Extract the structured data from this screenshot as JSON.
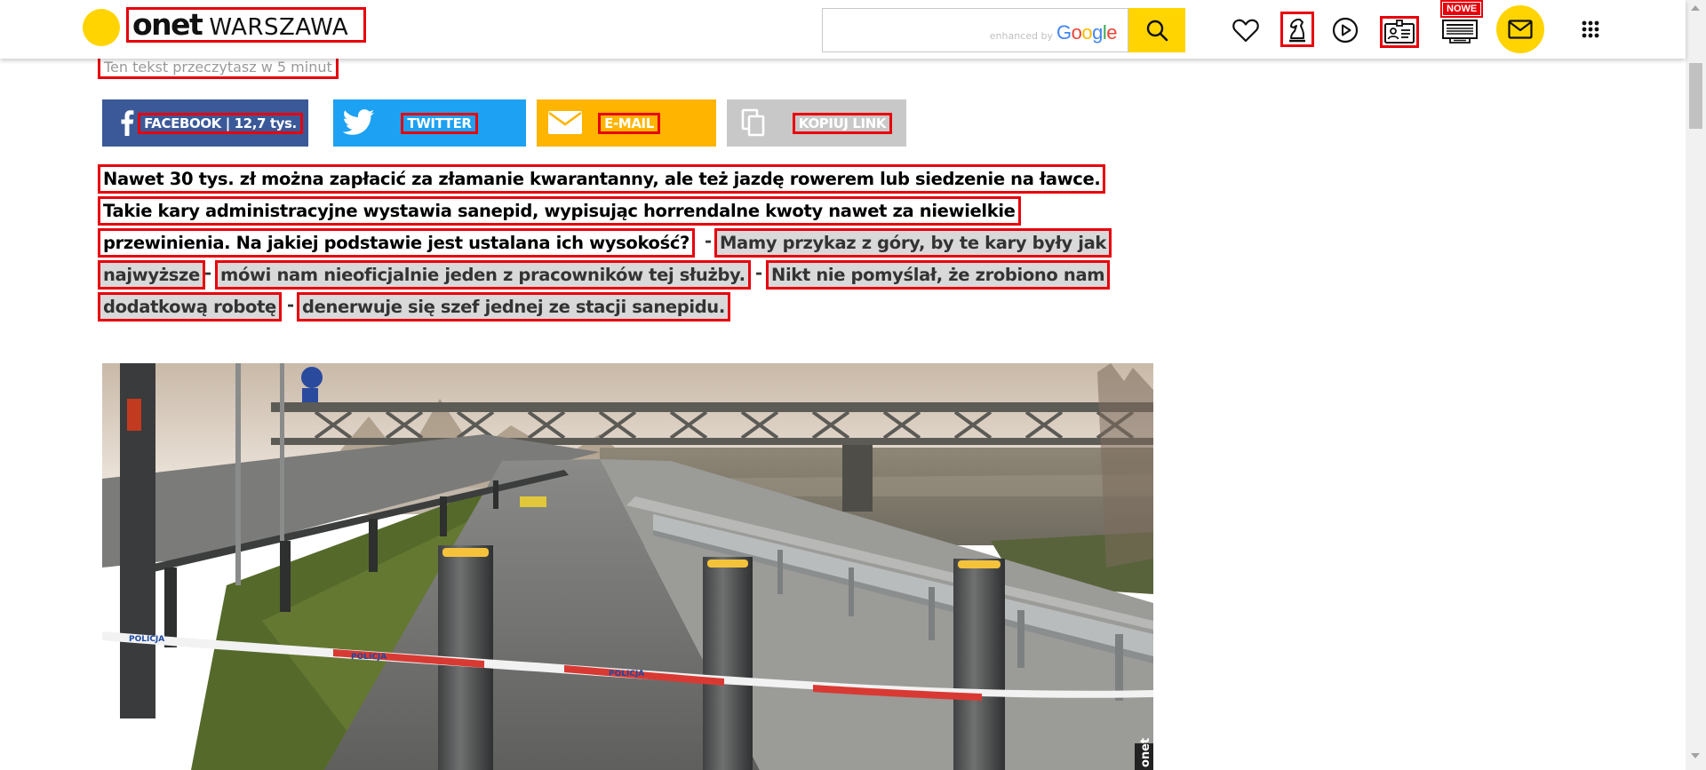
{
  "header": {
    "logo_brand": "onet",
    "logo_city": "WARSZAWA",
    "search": {
      "placeholder": "",
      "powered_by": "enhanced by",
      "provider": "Google"
    },
    "icons": [
      "heart-icon",
      "chess-knight-icon",
      "play-icon",
      "id-card-icon",
      "newspaper-icon",
      "mail-icon",
      "apps-grid-icon"
    ],
    "nowe_badge": "NOWE",
    "colors": {
      "brand_yellow": "#ffd400",
      "highlight_red": "#e8000b"
    }
  },
  "article": {
    "read_time": "Ten tekst przeczytasz w 5 minut",
    "share": {
      "facebook": "FACEBOOK | 12,7 tys.",
      "twitter": "TWITTER",
      "email": "E-MAIL",
      "copy_link": "KOPIUJ LINK",
      "colors": {
        "facebook": "#3b5998",
        "twitter": "#1da1f2",
        "email": "#ffb400",
        "copy_link": "#c8c8c8"
      }
    },
    "lead": {
      "line1": "Nawet 30 tys. zł można zapłacić za złamanie kwarantanny, ale też jazdę rowerem lub siedzenie na ławce.",
      "line2": "Takie kary administracyjne wystawia sanepid, wypisując horrendalne kwoty nawet za niewielkie",
      "line3a": "przewinienia. Na jakiej podstawie jest ustalana ich wysokość?",
      "dash": "-",
      "quote1a": "Mamy przykaz z góry, by te kary były jak",
      "quote1b": "najwyższe",
      "attrib1": "mówi nam nieoficjalnie jeden z pracowników tej służby.",
      "quote2a": "Nikt nie pomyślał, że zrobiono nam",
      "quote2b": "dodatkową robotę",
      "attrib2": "denerwuje się szef jednej ze stacji sanepidu."
    },
    "photo": {
      "tape_text": "POLICJA",
      "watermark": "onet"
    }
  }
}
